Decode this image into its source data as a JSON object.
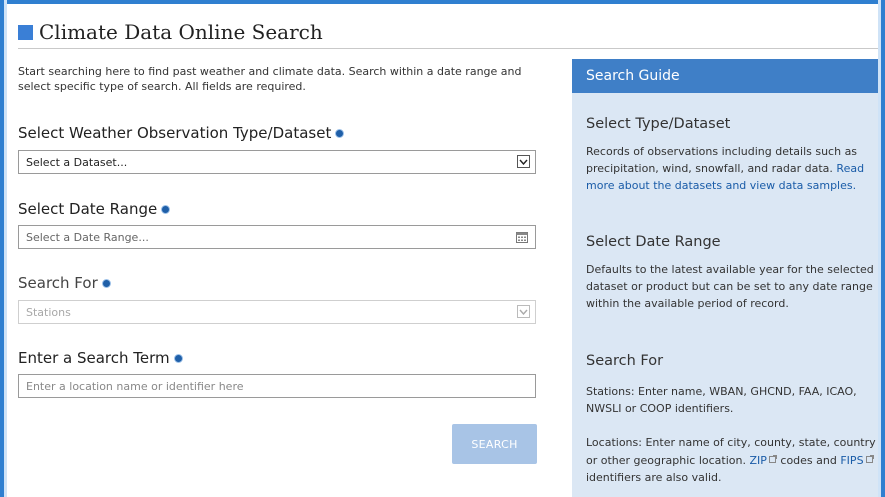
{
  "page": {
    "title": "Climate Data Online Search",
    "intro": "Start searching here to find past weather and climate data. Search within a date range and select specific type of search. All fields are required."
  },
  "form": {
    "dataset": {
      "label": "Select Weather Observation Type/Dataset",
      "value": "Select a Dataset..."
    },
    "date_range": {
      "label": "Select Date Range",
      "placeholder": "Select a Date Range..."
    },
    "search_for": {
      "label": "Search For",
      "value": "Stations"
    },
    "search_term": {
      "label": "Enter a Search Term",
      "placeholder": "Enter a location name or identifier here"
    },
    "search_button": "SEARCH"
  },
  "guide": {
    "header": "Search Guide",
    "type_title": "Select Type/Dataset",
    "type_text": "Records of observations including details such as precipitation, wind, snowfall, and radar data.",
    "type_link": "Read more about the datasets and view data samples.",
    "date_title": "Select Date Range",
    "date_text": "Defaults to the latest available year for the selected dataset or product but can be set to any date range within the available period of record.",
    "search_title": "Search For",
    "stations_text": "Stations: Enter name, WBAN, GHCND, FAA, ICAO, NWSLI or COOP identifiers.",
    "locations_text_a": "Locations: Enter name of city, county, state, country or other geographic location.",
    "zip_link": "ZIP",
    "locations_text_b": "codes and",
    "fips_link": "FIPS",
    "locations_text_c": "identifiers are also valid."
  },
  "colors": {
    "frame": "#2f7fd0",
    "guide_header": "#3f7fc7",
    "guide_bg": "#dbe7f4",
    "button_disabled": "#a8c4e6",
    "link": "#1a5ca8"
  },
  "icons": [
    "title-square-icon",
    "info-icon",
    "chevron-down-icon",
    "calendar-icon",
    "external-link-icon"
  ]
}
